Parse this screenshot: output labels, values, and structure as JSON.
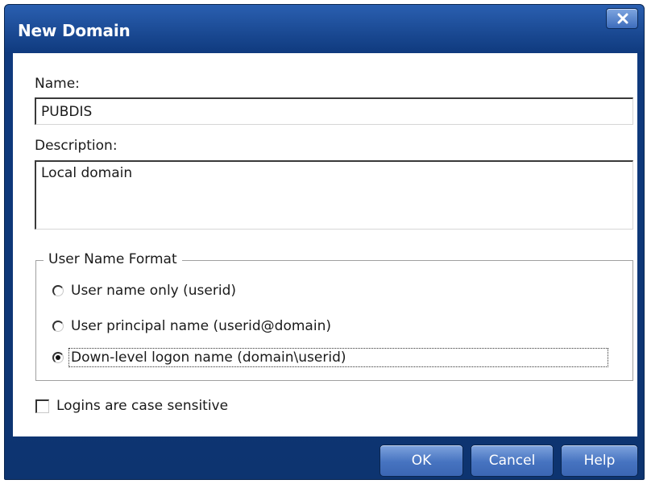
{
  "window": {
    "title": "New Domain",
    "close_icon": "close-icon"
  },
  "form": {
    "name_label": "Name:",
    "name_value": "PUBDIS",
    "description_label": "Description:",
    "description_value": "Local domain",
    "user_name_format": {
      "legend": "User Name Format",
      "options": [
        {
          "label": "User name only (userid)",
          "selected": false
        },
        {
          "label": "User principal name (userid@domain)",
          "selected": false
        },
        {
          "label": "Down-level logon name (domain\\userid)",
          "selected": true
        }
      ]
    },
    "case_sensitive": {
      "label": "Logins are case sensitive",
      "checked": false
    }
  },
  "buttons": {
    "ok": "OK",
    "cancel": "Cancel",
    "help": "Help"
  },
  "colors": {
    "frame": "#0f3a7e",
    "button": "#4673c0"
  }
}
